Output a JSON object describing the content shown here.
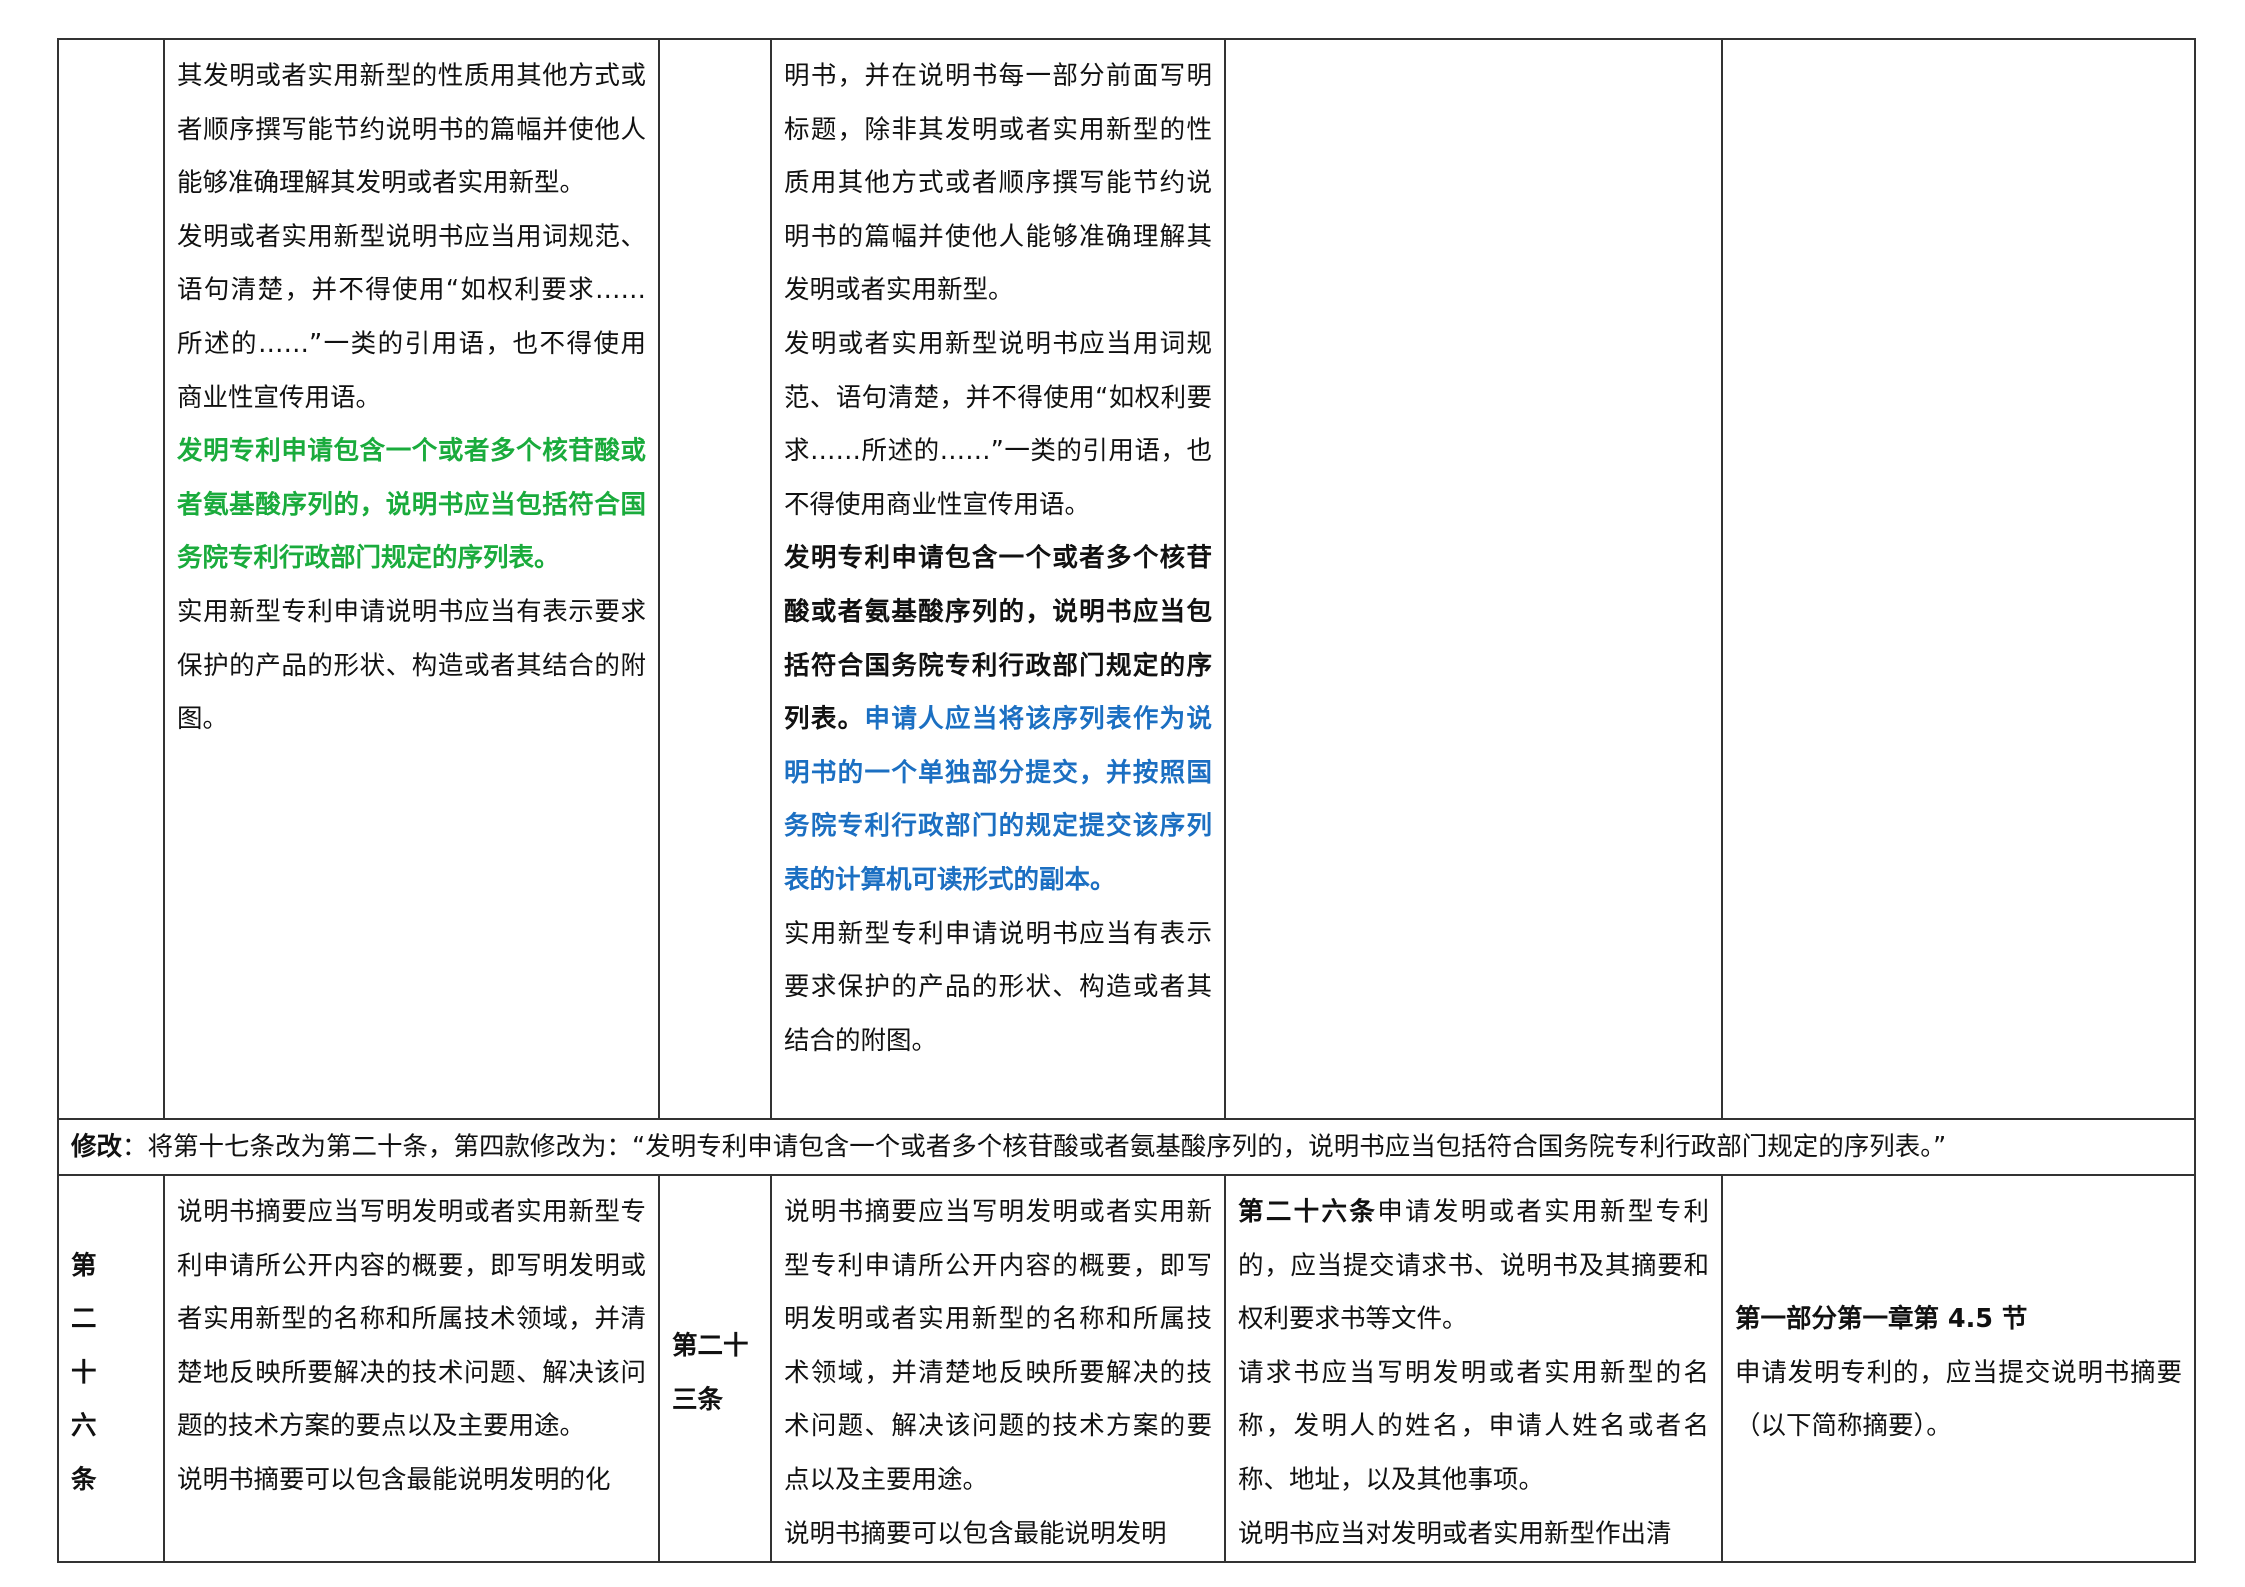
{
  "row1": {
    "col2": [
      "其发明或者实用新型的性质用其他方式或者顺序撰写能节约说明书的篇幅并使他人能够准确理解其发明或者实用新型。",
      "发明或者实用新型说明书应当用词规范、语句清楚，并不得使用“如权利要求……所述的……”一类的引用语，也不得使用商业性宣传用语。",
      "发明专利申请包含一个或者多个核苷酸或者氨基酸序列的，说明书应当包括符合国务院专利行政部门规定的序列表。",
      "实用新型专利申请说明书应当有表示要求保护的产品的形状、构造或者其结合的附图。"
    ],
    "col4": {
      "p1": "明书，并在说明书每一部分前面写明标题，除非其发明或者实用新型的性质用其他方式或者顺序撰写能节约说明书的篇幅并使他人能够准确理解其发明或者实用新型。",
      "p2": "发明或者实用新型说明书应当用词规范、语句清楚，并不得使用“如权利要求……所述的……”一类的引用语，也不得使用商业性宣传用语。",
      "p3_bold": "发明专利申请包含一个或者多个核苷酸或者氨基酸序列的，说明书应当包括符合国务院专利行政部门规定的序列表。",
      "p3_blue": "申请人应当将该序列表作为说明书的一个单独部分提交，并按照国务院专利行政部门的规定提交该序列表的计算机可读形式的副本。",
      "p4": "实用新型专利申请说明书应当有表示要求保护的产品的形状、构造或者其结合的附图。"
    }
  },
  "row2": {
    "label": "修改",
    "text": "：将第十七条改为第二十条，第四款修改为：“发明专利申请包含一个或者多个核苷酸或者氨基酸序列的，说明书应当包括符合国务院专利行政部门规定的序列表。”"
  },
  "row3": {
    "old_article": [
      "第　二",
      "十　六",
      "条"
    ],
    "col2": [
      "说明书摘要应当写明发明或者实用新型专利申请所公开内容的概要，即写明发明或者实用新型的名称和所属技术领域，并清楚地反映所要解决的技术问题、解决该问题的技术方案的要点以及主要用途。",
      "说明书摘要可以包含最能说明发明的化"
    ],
    "new_article": [
      "第二十",
      "三条"
    ],
    "col4": [
      "说明书摘要应当写明发明或者实用新型专利申请所公开内容的概要，即写明发明或者实用新型的名称和所属技术领域，并清楚地反映所要解决的技术问题、解决该问题的技术方案的要点以及主要用途。",
      "说明书摘要可以包含最能说明发明"
    ],
    "col5": {
      "lead_bold": "第二十六条",
      "lead_rest": "申请发明或者实用新型专利的，应当提交请求书、说明书及其摘要和权利要求书等文件。",
      "p2": "请求书应当写明发明或者实用新型的名称，发明人的姓名，申请人姓名或者名称、地址，以及其他事项。",
      "p3": "说明书应当对发明或者实用新型作出清"
    },
    "col6": {
      "title": "第一部分第一章第 4.5 节",
      "text": "申请发明专利的，应当提交说明书摘要（以下简称摘要）。"
    }
  }
}
